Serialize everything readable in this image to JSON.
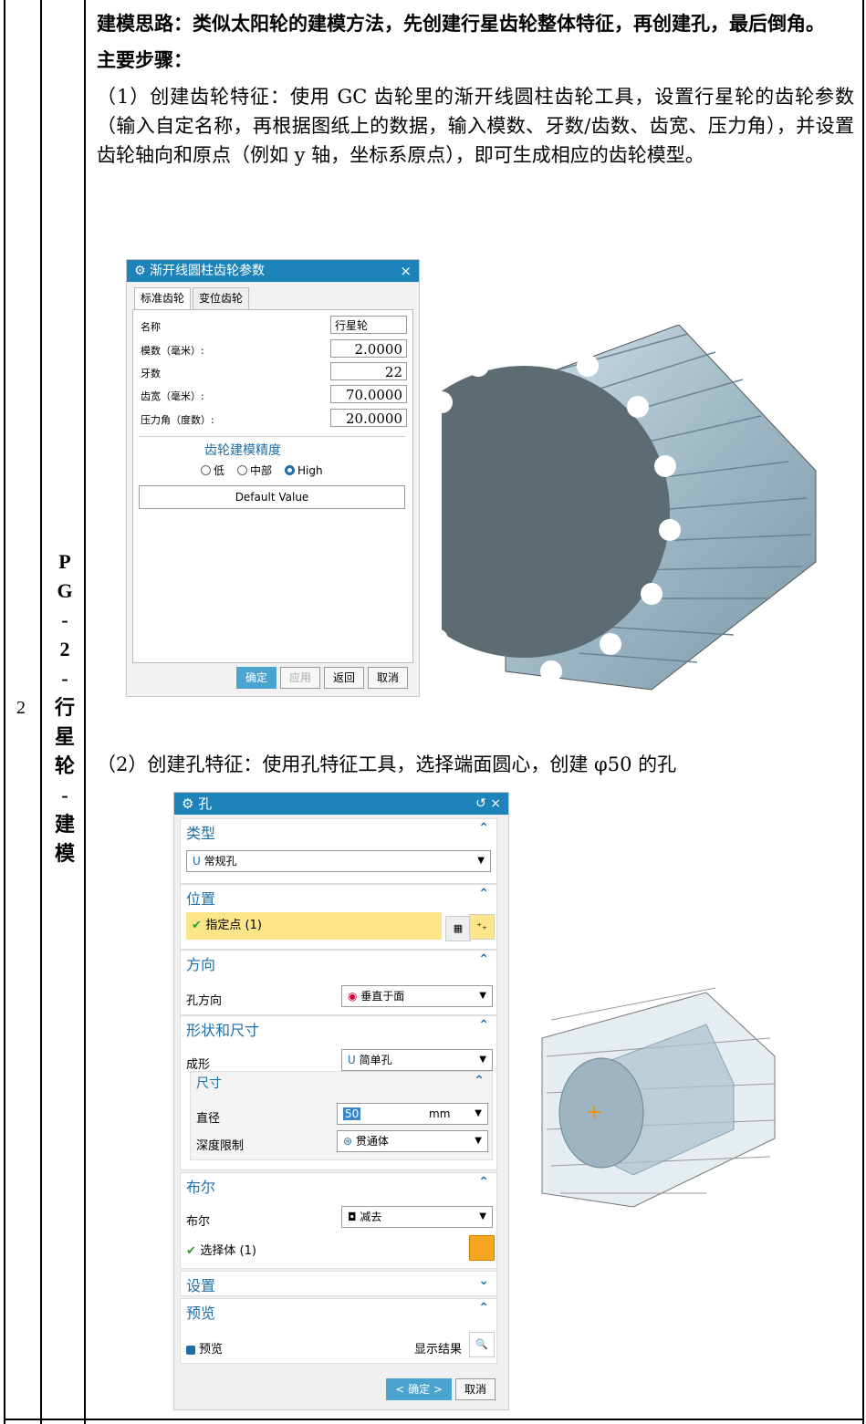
{
  "table": {
    "row_number": "2",
    "vertical_title": [
      "P",
      "G",
      "-",
      "2",
      "-",
      "行",
      "星",
      "轮",
      "-",
      "建",
      "模"
    ]
  },
  "content": {
    "idea": "建模思路：类似太阳轮的建模方法，先创建行星齿轮整体特征，再创建孔，最后倒角。",
    "steps_heading": "主要步骤：",
    "step1": "（1）创建齿轮特征：使用 GC 齿轮里的渐开线圆柱齿轮工具，设置行星轮的齿轮参数（输入自定名称，再根据图纸上的数据，输入模数、牙数/齿数、齿宽、压力角），并设置齿轮轴向和原点（例如 y 轴，坐标系原点），即可生成相应的齿轮模型。",
    "step2": "（2）创建孔特征：使用孔特征工具，选择端面圆心，创建 φ50 的孔"
  },
  "gear_dialog": {
    "title": "渐开线圆柱齿轮参数",
    "close": "×",
    "tabs": [
      "标准齿轮",
      "变位齿轮"
    ],
    "params": [
      {
        "label": "名称",
        "value": "行星轮"
      },
      {
        "label": "模数（毫米）:",
        "value": "2.0000"
      },
      {
        "label": "牙数",
        "value": "22"
      },
      {
        "label": "齿宽（毫米）:",
        "value": "70.0000"
      },
      {
        "label": "压力角（度数）:",
        "value": "20.0000"
      }
    ],
    "precision_title": "齿轮建模精度",
    "precision_options": [
      "低",
      "中部",
      "High"
    ],
    "precision_selected": "High",
    "default_button": "Default Value",
    "buttons": {
      "ok": "确定",
      "apply": "应用",
      "back": "返回",
      "cancel": "取消"
    }
  },
  "hole_dialog": {
    "title": "孔",
    "controls": "↺ ×",
    "type_section": "类型",
    "type_value": "常规孔",
    "position_section": "位置",
    "specify_point": "指定点 (1)",
    "direction_section": "方向",
    "hole_direction_label": "孔方向",
    "hole_direction_value": "垂直于面",
    "shape_section": "形状和尺寸",
    "form_label": "成形",
    "form_value": "简单孔",
    "dimensions_section": "尺寸",
    "diameter_label": "直径",
    "diameter_value": "50",
    "diameter_unit": "mm",
    "depth_label": "深度限制",
    "depth_value": "贯通体",
    "boolean_section": "布尔",
    "boolean_label": "布尔",
    "boolean_value": "减去",
    "select_body": "选择体 (1)",
    "settings_section": "设置",
    "preview_section": "预览",
    "preview_check": "预览",
    "show_result": "显示结果",
    "ok": "< 确定 >",
    "cancel": "取消"
  },
  "colors": {
    "dialog_title": "#1e83b8",
    "section_heading": "#1e6fa8",
    "highlight": "#fde58a",
    "gear_face": "#5d6b72",
    "gear_body": "#a9c2cf"
  }
}
